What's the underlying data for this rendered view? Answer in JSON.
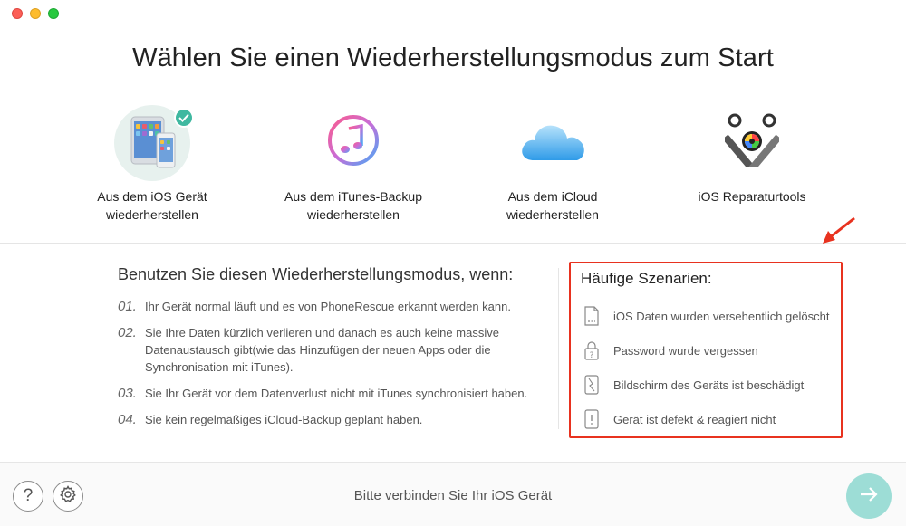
{
  "window": {
    "title": "Wählen Sie einen Wiederherstellungsmodus zum Start"
  },
  "modes": [
    {
      "label_line1": "Aus dem iOS Gerät",
      "label_line2": "wiederherstellen",
      "icon": "ios-devices-icon",
      "selected": true
    },
    {
      "label_line1": "Aus dem iTunes-Backup",
      "label_line2": "wiederherstellen",
      "icon": "itunes-icon",
      "selected": false
    },
    {
      "label_line1": "Aus dem iCloud",
      "label_line2": "wiederherstellen",
      "icon": "icloud-icon",
      "selected": false
    },
    {
      "label_line1": "iOS Reparaturtools",
      "label_line2": "",
      "icon": "repair-tools-icon",
      "selected": false
    }
  ],
  "info": {
    "heading": "Benutzen Sie diesen Wiederherstellungsmodus, wenn:",
    "items": [
      {
        "num": "01.",
        "text": "Ihr Gerät normal läuft und es von PhoneRescue erkannt werden kann."
      },
      {
        "num": "02.",
        "text": "Sie Ihre Daten kürzlich verlieren und danach es auch keine massive Datenaustausch gibt(wie das Hinzufügen der neuen Apps oder die Synchronisation mit iTunes)."
      },
      {
        "num": "03.",
        "text": "Sie Ihr Gerät vor dem Datenverlust nicht mit iTunes synchronisiert haben."
      },
      {
        "num": "04.",
        "text": "Sie kein regelmäßiges iCloud-Backup geplant haben."
      }
    ]
  },
  "scenarios": {
    "heading": "Häufige Szenarien:",
    "items": [
      {
        "text": "iOS Daten wurden versehentlich gelöscht",
        "icon": "deleted-data-icon"
      },
      {
        "text": "Password wurde vergessen",
        "icon": "lock-question-icon"
      },
      {
        "text": "Bildschirm des Geräts ist beschädigt",
        "icon": "broken-screen-icon"
      },
      {
        "text": "Gerät ist defekt & reagiert nicht",
        "icon": "device-alert-icon"
      }
    ]
  },
  "bottom": {
    "help_label": "?",
    "status": "Bitte verbinden Sie Ihr iOS Gerät"
  },
  "colors": {
    "accent": "#48b7a6",
    "highlight_box": "#e8321f",
    "next_button": "#9dddd6"
  }
}
